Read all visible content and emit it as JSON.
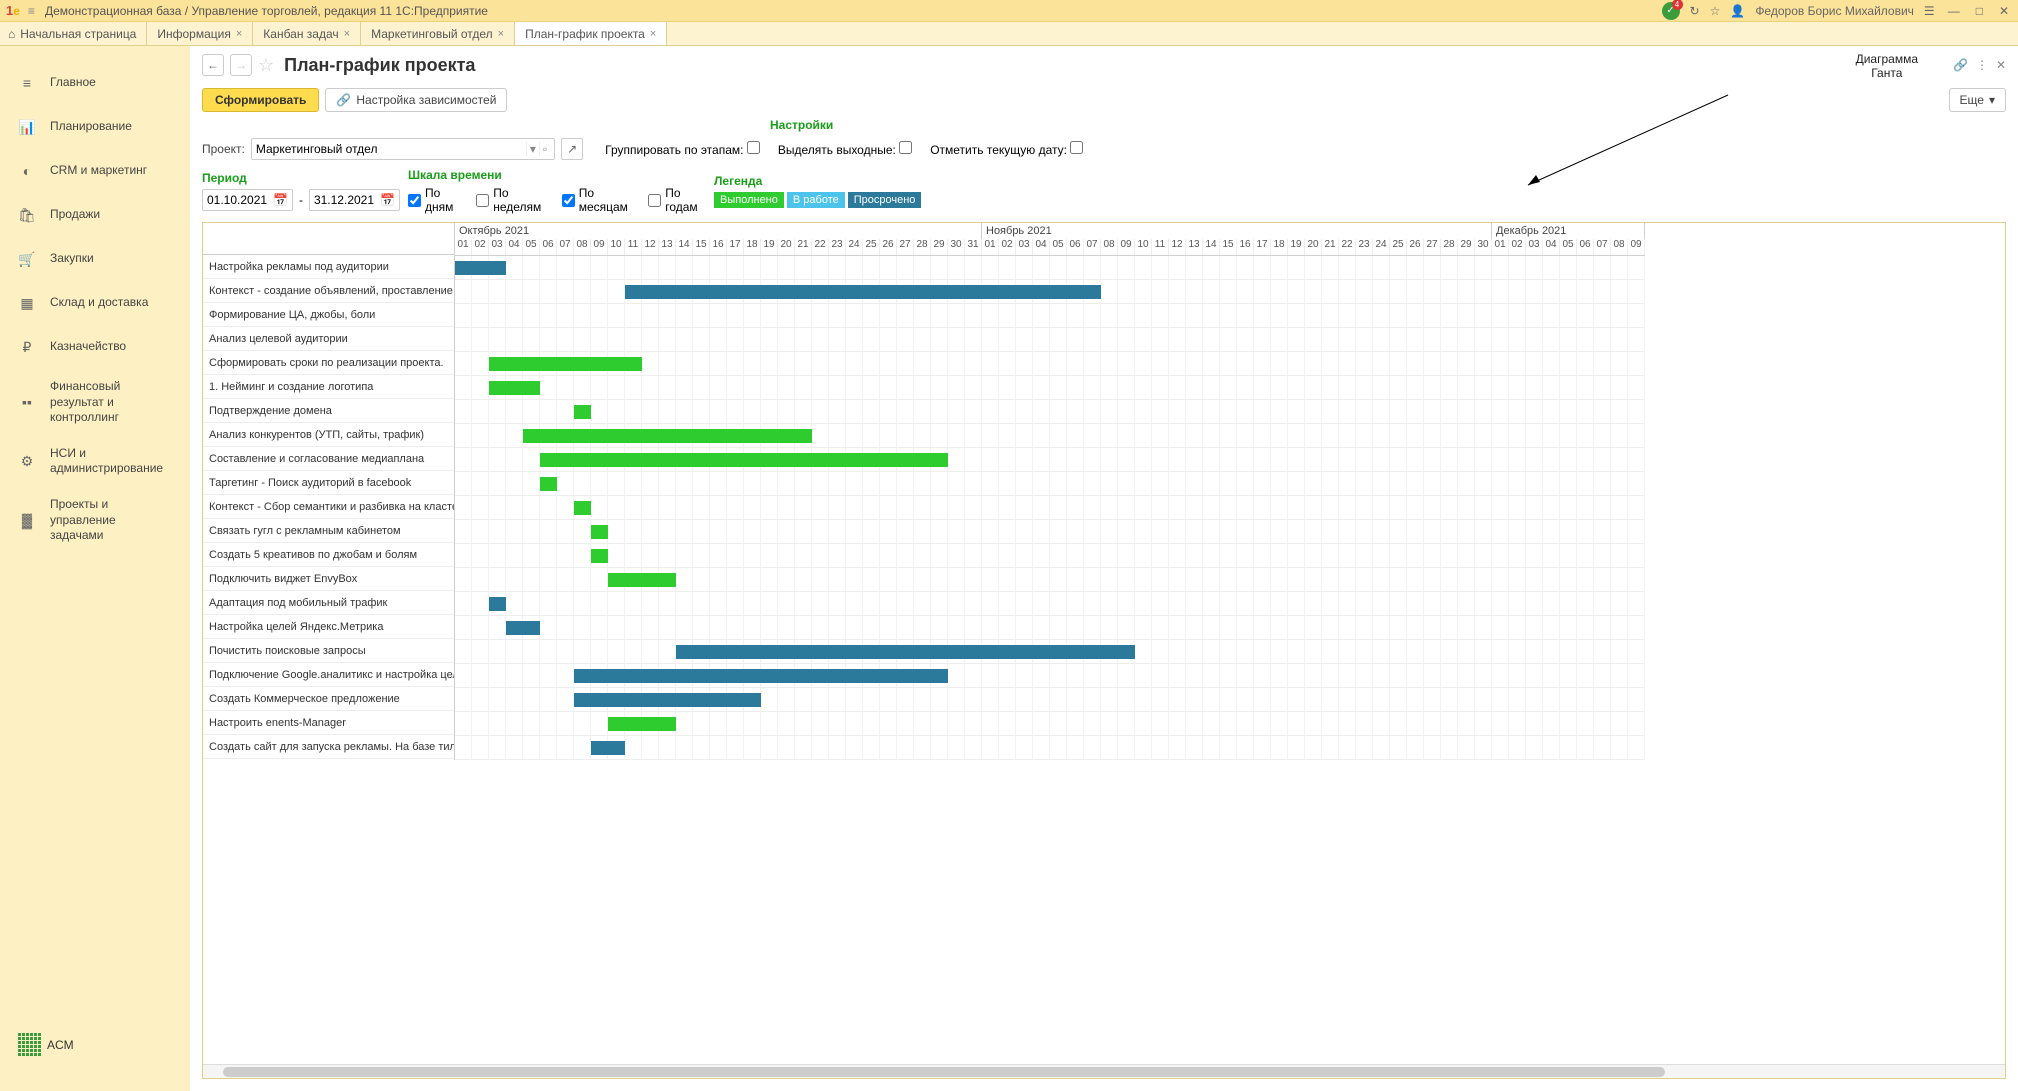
{
  "titlebar": {
    "logo": "1C",
    "title": "Демонстрационная база / Управление торговлей, редакция 11 1С:Предприятие",
    "user": "Федоров Борис Михайлович",
    "notif_count": "4"
  },
  "tabs": {
    "home": "Начальная страница",
    "items": [
      "Информация",
      "Канбан задач",
      "Маркетинговый отдел",
      "План-график проекта"
    ],
    "active": 3
  },
  "sidebar": {
    "items": [
      {
        "icon": "≡",
        "label": "Главное"
      },
      {
        "icon": "📊",
        "label": "Планирование"
      },
      {
        "icon": "◐",
        "label": "CRM и маркетинг"
      },
      {
        "icon": "🛍",
        "label": "Продажи"
      },
      {
        "icon": "🛒",
        "label": "Закупки"
      },
      {
        "icon": "▦",
        "label": "Склад и доставка"
      },
      {
        "icon": "₽",
        "label": "Казначейство"
      },
      {
        "icon": "▪▪",
        "label": "Финансовый результат и контроллинг"
      },
      {
        "icon": "⚙",
        "label": "НСИ и администрирование"
      },
      {
        "icon": "▓",
        "label": "Проекты и управление задачами"
      }
    ],
    "logo": "ACM"
  },
  "page": {
    "title": "План-график проекта",
    "generate_btn": "Сформировать",
    "deps_btn": "Настройка зависимостей",
    "more_btn": "Еще"
  },
  "project": {
    "label": "Проект:",
    "value": "Маркетинговый отдел"
  },
  "settings": {
    "title": "Настройки",
    "group_by_stages": "Группировать по этапам:",
    "highlight_weekends": "Выделять выходные:",
    "mark_current_date": "Отметить текущую дату:"
  },
  "period": {
    "title": "Период",
    "from": "01.10.2021",
    "to": "31.12.2021"
  },
  "scale": {
    "title": "Шкала времени",
    "by_days": "По дням",
    "by_days_checked": true,
    "by_weeks": "По неделям",
    "by_weeks_checked": false,
    "by_months": "По месяцам",
    "by_months_checked": true,
    "by_years": "По годам",
    "by_years_checked": false
  },
  "legend": {
    "title": "Легенда",
    "done": "Выполнено",
    "in_work": "В работе",
    "overdue": "Просрочено"
  },
  "annotation": {
    "line1": "Диаграмма",
    "line2": "Ганта"
  },
  "chart_data": {
    "type": "gantt",
    "months": [
      {
        "name": "Октябрь 2021",
        "days": 31,
        "start_day": 1
      },
      {
        "name": "Ноябрь 2021",
        "days": 30,
        "start_day": 1
      },
      {
        "name": "Декабрь 2021",
        "days": 9,
        "start_day": 1,
        "partial": true
      }
    ],
    "day_headers": [
      "01",
      "02",
      "03",
      "04",
      "05",
      "06",
      "07",
      "08",
      "09",
      "10",
      "11",
      "12",
      "13",
      "14",
      "15",
      "16",
      "17",
      "18",
      "19",
      "20",
      "21",
      "22",
      "23",
      "24",
      "25",
      "26",
      "27",
      "28",
      "29",
      "30",
      "31",
      "01",
      "02",
      "03",
      "04",
      "05",
      "06",
      "07",
      "08",
      "09",
      "10",
      "11",
      "12",
      "13",
      "14",
      "15",
      "16",
      "17",
      "18",
      "19",
      "20",
      "21",
      "22",
      "23",
      "24",
      "25",
      "26",
      "27",
      "28",
      "29",
      "30",
      "01",
      "02",
      "03",
      "04",
      "05",
      "06",
      "07",
      "08",
      "09"
    ],
    "tasks": [
      {
        "name": "Настройка рекламы под аудитории",
        "start": 0,
        "len": 3,
        "cls": "bar-blue"
      },
      {
        "name": "Контекст - создание объявлений, проставление с...",
        "start": 10,
        "len": 28,
        "cls": "bar-blue"
      },
      {
        "name": "Формирование ЦА, джобы, боли",
        "start": 0,
        "len": 0,
        "cls": ""
      },
      {
        "name": "Анализ целевой аудитории",
        "start": 0,
        "len": 0,
        "cls": ""
      },
      {
        "name": "Сформировать сроки по реализации проекта.",
        "start": 2,
        "len": 9,
        "cls": "bar-green"
      },
      {
        "name": "1. Нейминг и создание логотипа",
        "start": 2,
        "len": 3,
        "cls": "bar-green"
      },
      {
        "name": "Подтверждение домена",
        "start": 7,
        "len": 1,
        "cls": "bar-green"
      },
      {
        "name": "Анализ конкурентов (УТП, сайты, трафик)",
        "start": 4,
        "len": 17,
        "cls": "bar-green"
      },
      {
        "name": "Составление и согласование медиаплана",
        "start": 5,
        "len": 24,
        "cls": "bar-green"
      },
      {
        "name": "Таргетинг - Поиск аудиторий в facebook",
        "start": 5,
        "len": 1,
        "cls": "bar-green"
      },
      {
        "name": "Контекст - Сбор семантики и разбивка на кластеры",
        "start": 7,
        "len": 1,
        "cls": "bar-green"
      },
      {
        "name": "Связать гугл с рекламным кабинетом",
        "start": 8,
        "len": 1,
        "cls": "bar-green"
      },
      {
        "name": "Создать 5 креативов по джобам и болям",
        "start": 8,
        "len": 1,
        "cls": "bar-green"
      },
      {
        "name": "Подключить виджет EnvyBox",
        "start": 9,
        "len": 4,
        "cls": "bar-green"
      },
      {
        "name": "Адаптация под мобильный трафик",
        "start": 2,
        "len": 1,
        "cls": "bar-blue"
      },
      {
        "name": "Настройка целей Яндекс.Метрика",
        "start": 3,
        "len": 2,
        "cls": "bar-blue"
      },
      {
        "name": "Почистить поисковые запросы",
        "start": 13,
        "len": 27,
        "cls": "bar-blue"
      },
      {
        "name": "Подключение Google.аналитикс и настройка целей",
        "start": 7,
        "len": 22,
        "cls": "bar-blue"
      },
      {
        "name": "Создать Коммерческое предложение",
        "start": 7,
        "len": 11,
        "cls": "bar-blue"
      },
      {
        "name": "Настроить enents-Manager",
        "start": 9,
        "len": 4,
        "cls": "bar-green"
      },
      {
        "name": "Создать сайт для запуска рекламы. На базе тильды",
        "start": 8,
        "len": 2,
        "cls": "bar-blue"
      }
    ]
  }
}
